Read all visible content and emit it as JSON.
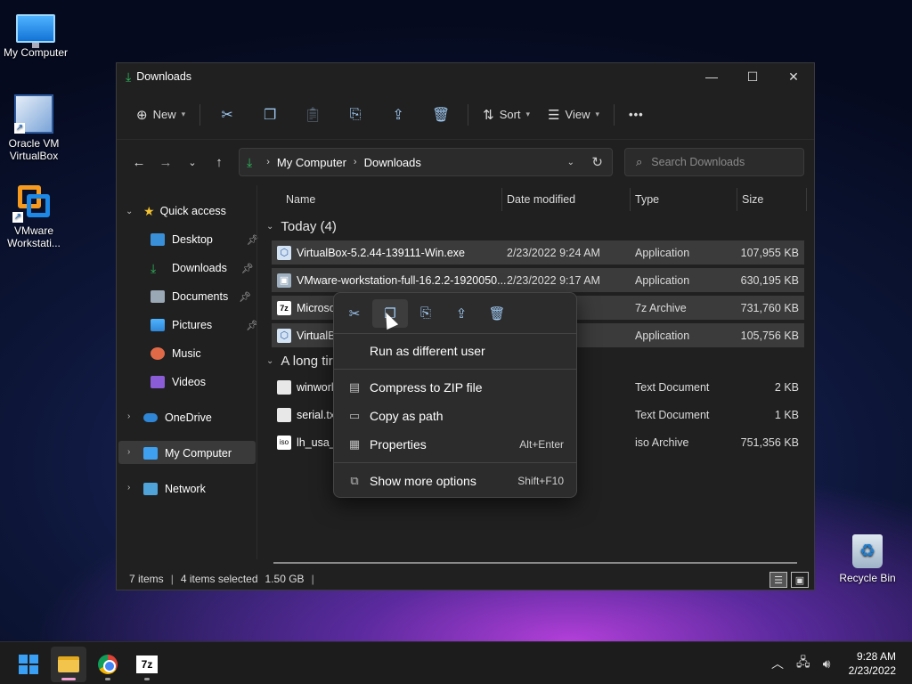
{
  "desktop": {
    "icons": [
      {
        "label": "My Computer"
      },
      {
        "label": "Oracle VM VirtualBox"
      },
      {
        "label": "VMware Workstati..."
      },
      {
        "label": "Recycle Bin"
      }
    ]
  },
  "window": {
    "title": "Downloads",
    "controls": {
      "minimize": "—",
      "maximize": "☐",
      "close": "✕"
    }
  },
  "toolbar": {
    "new_label": "New",
    "sort_label": "Sort",
    "view_label": "View",
    "more_label": "•••"
  },
  "address": {
    "crumbs": [
      "My Computer",
      "Downloads"
    ],
    "search_placeholder": "Search Downloads"
  },
  "sidebar": {
    "items": [
      {
        "label": "Quick access"
      },
      {
        "label": "Desktop"
      },
      {
        "label": "Downloads"
      },
      {
        "label": "Documents"
      },
      {
        "label": "Pictures"
      },
      {
        "label": "Music"
      },
      {
        "label": "Videos"
      },
      {
        "label": "OneDrive"
      },
      {
        "label": "My Computer"
      },
      {
        "label": "Network"
      }
    ]
  },
  "columns": {
    "name": "Name",
    "date": "Date modified",
    "type": "Type",
    "size": "Size"
  },
  "groups": {
    "today": "Today (4)",
    "long_ago": "A long tir"
  },
  "files": [
    {
      "name": "VirtualBox-5.2.44-139111-Win.exe",
      "date": "2/23/2022 9:24 AM",
      "type": "Application",
      "size": "107,955 KB"
    },
    {
      "name": "VMware-workstation-full-16.2.2-1920050...",
      "date": "2/23/2022 9:17 AM",
      "type": "Application",
      "size": "630,195 KB"
    },
    {
      "name": "Microsof",
      "date": "AM",
      "type": "7z Archive",
      "size": "731,760 KB"
    },
    {
      "name": "VirtualBo",
      "date": "AM",
      "type": "Application",
      "size": "105,756 KB"
    },
    {
      "name": "winworld",
      "date": "PM",
      "type": "Text Document",
      "size": "2 KB"
    },
    {
      "name": "serial.txt",
      "date": "PM",
      "type": "Text Document",
      "size": "1 KB"
    },
    {
      "name": "lh_usa_4",
      "date": "M",
      "type": "iso Archive",
      "size": "751,356 KB"
    }
  ],
  "status": {
    "items": "7 items",
    "selected": "4 items selected",
    "size": "1.50 GB"
  },
  "context_menu": {
    "run_as": "Run as different user",
    "compress": "Compress to ZIP file",
    "copy_path": "Copy as path",
    "properties": "Properties",
    "properties_key": "Alt+Enter",
    "more_options": "Show more options",
    "more_options_key": "Shift+F10"
  },
  "taskbar": {
    "time": "9:28 AM",
    "date": "2/23/2022",
    "sevenzip_label": "7z"
  }
}
